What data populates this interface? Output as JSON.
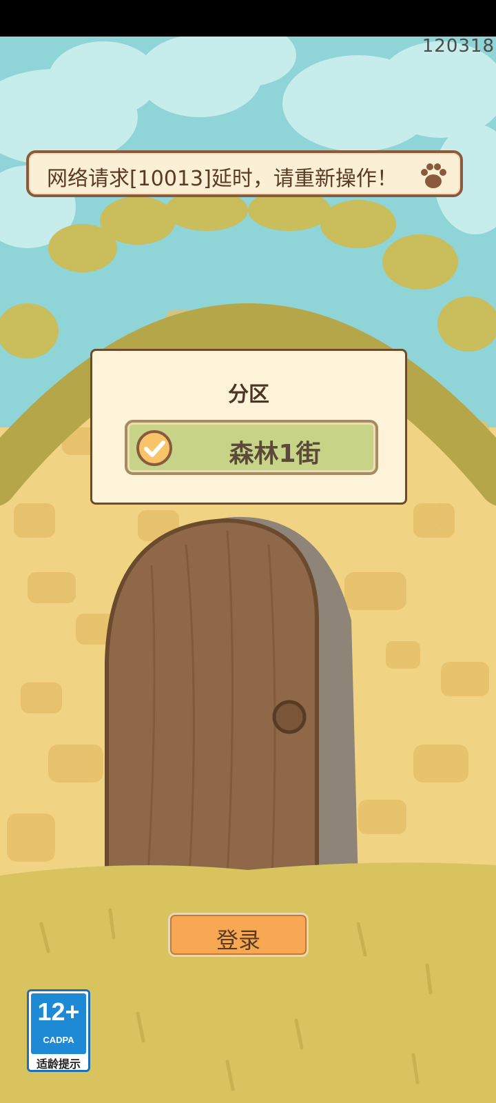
{
  "version_code": "120318",
  "toast": {
    "message": "网络请求[10013]延时，请重新操作！",
    "icon": "paw-icon"
  },
  "server_panel": {
    "title": "分区",
    "selected_server": "森林1街",
    "check_icon": "check-circle-icon"
  },
  "login": {
    "label": "登录"
  },
  "age_rating": {
    "age": "12+",
    "org": "CADPA",
    "hint": "适龄提示"
  },
  "colors": {
    "sky": "#8fd4d6",
    "wall": "#f0d483",
    "foliage": "#b5a64a",
    "door": "#8e6848",
    "grass": "#d8c35f",
    "login_button": "#f8a852",
    "server_button": "#c7d487"
  }
}
